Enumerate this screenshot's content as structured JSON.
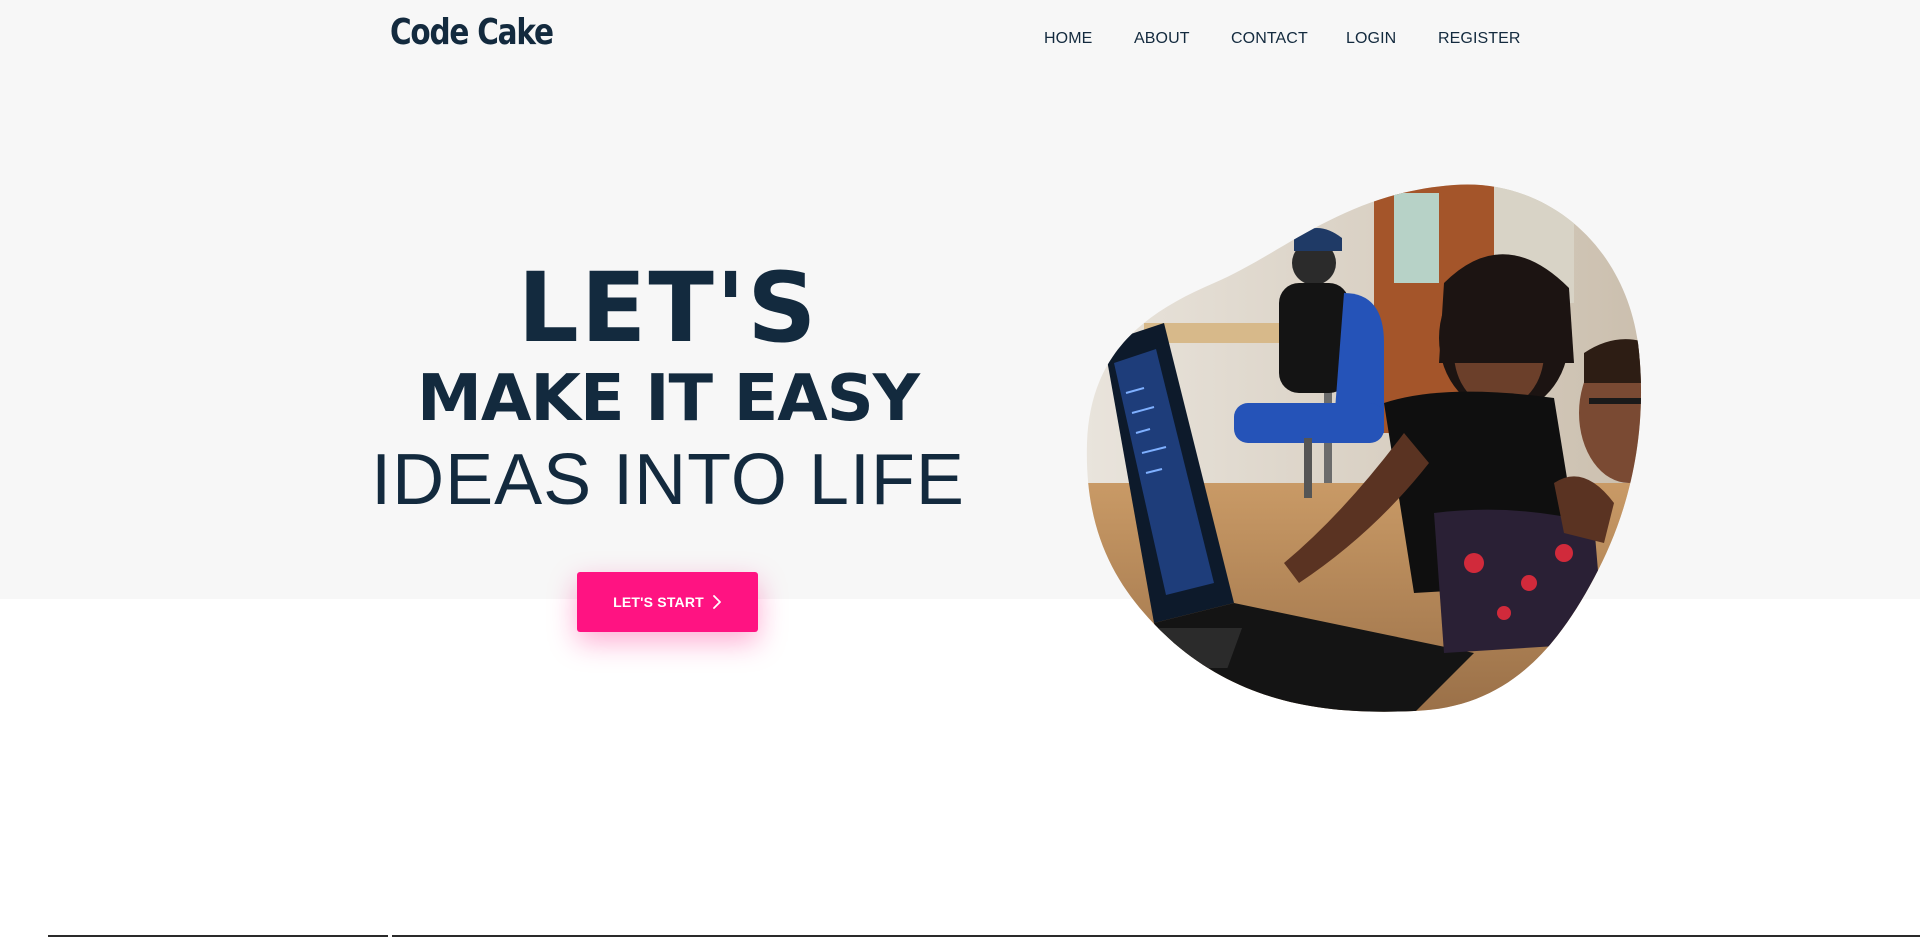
{
  "brand": {
    "name": "Code Cake"
  },
  "nav": {
    "items": [
      {
        "label": "HOME"
      },
      {
        "label": "ABOUT"
      },
      {
        "label": "CONTACT"
      },
      {
        "label": "LOGIN"
      },
      {
        "label": "REGISTER"
      }
    ]
  },
  "hero": {
    "line1": "LET'S",
    "line2": "MAKE IT EASY",
    "line3": "IDEAS INTO LIFE",
    "cta_label": "LET'S START",
    "image_alt": "Developers working together at a laptop"
  },
  "colors": {
    "text": "#132a3e",
    "accent": "#ff1382",
    "hero_background": "#f7f7f7"
  },
  "icons": {
    "cta": "chevron-right-icon"
  }
}
